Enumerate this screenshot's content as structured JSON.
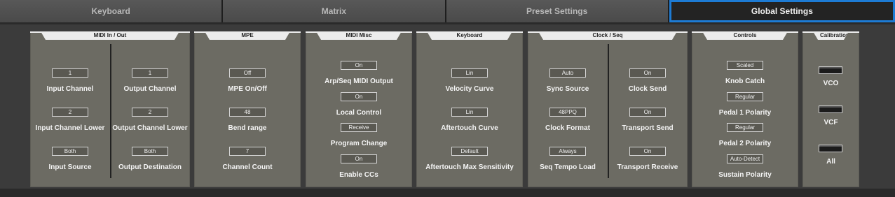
{
  "tabs": [
    "Keyboard",
    "Matrix",
    "Preset Settings",
    "Global Settings"
  ],
  "active_tab": "Global Settings",
  "panels": {
    "midi_io": {
      "title": "MIDI In / Out",
      "input_channel": {
        "value": "1",
        "label": "Input Channel"
      },
      "output_channel": {
        "value": "1",
        "label": "Output Channel"
      },
      "input_channel_lower": {
        "value": "2",
        "label": "Input Channel Lower"
      },
      "output_channel_lower": {
        "value": "2",
        "label": "Output Channel Lower"
      },
      "input_source": {
        "value": "Both",
        "label": "Input Source"
      },
      "output_destination": {
        "value": "Both",
        "label": "Output Destination"
      }
    },
    "mpe": {
      "title": "MPE",
      "mpe_on_off": {
        "value": "Off",
        "label": "MPE On/Off"
      },
      "bend_range": {
        "value": "48",
        "label": "Bend range"
      },
      "channel_count": {
        "value": "7",
        "label": "Channel Count"
      }
    },
    "midi_misc": {
      "title": "MIDI Misc",
      "arp_seq_midi_output": {
        "value": "On",
        "label": "Arp/Seq MIDI Output"
      },
      "local_control": {
        "value": "On",
        "label": "Local Control"
      },
      "program_change": {
        "value": "Receive",
        "label": "Program Change"
      },
      "enable_ccs": {
        "value": "On",
        "label": "Enable CCs"
      }
    },
    "keyboard": {
      "title": "Keyboard",
      "velocity_curve": {
        "value": "Lin",
        "label": "Velocity Curve"
      },
      "aftertouch_curve": {
        "value": "Lin",
        "label": "Aftertouch Curve"
      },
      "aftertouch_max_sensitivity": {
        "value": "Default",
        "label": "Aftertouch Max Sensitivity"
      }
    },
    "clock_seq": {
      "title": "Clock / Seq",
      "sync_source": {
        "value": "Auto",
        "label": "Sync Source"
      },
      "clock_send": {
        "value": "On",
        "label": "Clock Send"
      },
      "clock_format": {
        "value": "48PPQ",
        "label": "Clock Format"
      },
      "transport_send": {
        "value": "On",
        "label": "Transport Send"
      },
      "seq_tempo_load": {
        "value": "Always",
        "label": "Seq Tempo Load"
      },
      "transport_receive": {
        "value": "On",
        "label": "Transport Receive"
      }
    },
    "controls": {
      "title": "Controls",
      "knob_catch": {
        "value": "Scaled",
        "label": "Knob Catch"
      },
      "pedal_1_polarity": {
        "value": "Regular",
        "label": "Pedal 1 Polarity"
      },
      "pedal_2_polarity": {
        "value": "Regular",
        "label": "Pedal 2 Polarity"
      },
      "sustain_polarity": {
        "value": "Auto-Detect",
        "label": "Sustain Polarity"
      }
    },
    "calibration": {
      "title": "Calibration",
      "vco": "VCO",
      "vcf": "VCF",
      "all": "All"
    }
  }
}
